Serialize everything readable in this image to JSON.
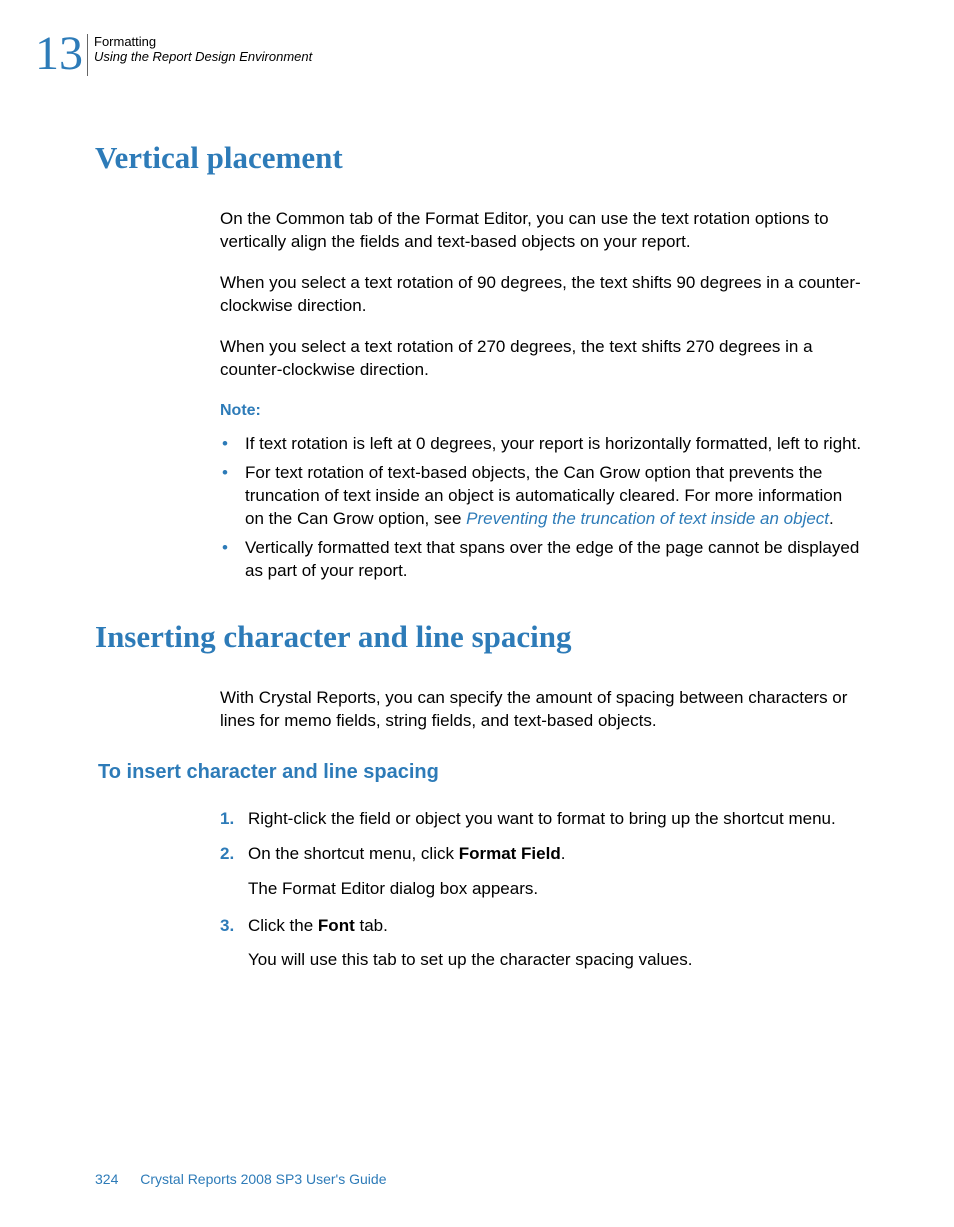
{
  "header": {
    "chapter_number": "13",
    "chapter_title": "Formatting",
    "section_title": "Using the Report Design Environment"
  },
  "section1": {
    "heading": "Vertical placement",
    "para1": "On the Common tab of the Format Editor, you can use the text rotation options to vertically align the fields and text-based objects on your report.",
    "para2": "When you select a text rotation of 90 degrees, the text shifts 90 degrees in a counter-clockwise direction.",
    "para3": "When you select a text rotation of 270 degrees, the text shifts 270 degrees in a counter-clockwise direction.",
    "note_label": "Note:",
    "bullets": {
      "b1": "If text rotation is left at 0 degrees, your report is horizontally formatted, left to right.",
      "b2_pre": "For text rotation of text-based objects, the Can Grow option that prevents the truncation of text inside an object is automatically cleared. For more information on the Can Grow option, see ",
      "b2_link": "Preventing the truncation of text inside an object",
      "b2_post": ".",
      "b3": "Vertically formatted text that spans over the edge of the page cannot be displayed as part of your report."
    }
  },
  "section2": {
    "heading": "Inserting character and line spacing",
    "para1": "With Crystal Reports, you can specify the amount of spacing between characters or lines for memo fields, string fields, and text-based objects.",
    "subheading": "To insert character and line spacing",
    "steps": {
      "n1": "1.",
      "s1": "Right-click the field or object you want to format to bring up the shortcut menu.",
      "n2": "2.",
      "s2_pre": "On the shortcut menu, click ",
      "s2_bold": "Format Field",
      "s2_post": ".",
      "s2_sub": "The Format Editor dialog box appears.",
      "n3": "3.",
      "s3_pre": "Click the ",
      "s3_bold": "Font",
      "s3_post": " tab.",
      "s3_sub": "You will use this tab to set up the character spacing values."
    }
  },
  "footer": {
    "page": "324",
    "doc_title": "Crystal Reports 2008 SP3 User's Guide"
  }
}
